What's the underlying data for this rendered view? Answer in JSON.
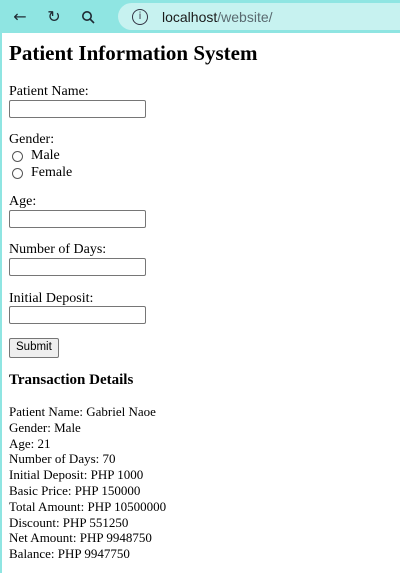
{
  "browser": {
    "url_host": "localhost",
    "url_path": "/website/"
  },
  "form": {
    "title": "Patient Information System",
    "patient_name_label": "Patient Name:",
    "gender_label": "Gender:",
    "gender_male": "Male",
    "gender_female": "Female",
    "age_label": "Age:",
    "days_label": "Number of Days:",
    "deposit_label": "Initial Deposit:",
    "submit_label": "Submit"
  },
  "transaction": {
    "heading": "Transaction Details",
    "lines": [
      "Patient Name: Gabriel Naoe",
      "Gender: Male",
      "Age: 21",
      "Number of Days: 70",
      "Initial Deposit: PHP 1000",
      "Basic Price: PHP 150000",
      "Total Amount: PHP 10500000",
      "Discount: PHP 551250",
      "Net Amount: PHP 9948750",
      "Balance: PHP 9947750"
    ]
  },
  "icons": {
    "back": "arrow-left-icon",
    "reload": "reload-icon",
    "search": "search-icon",
    "info": "info-icon"
  }
}
